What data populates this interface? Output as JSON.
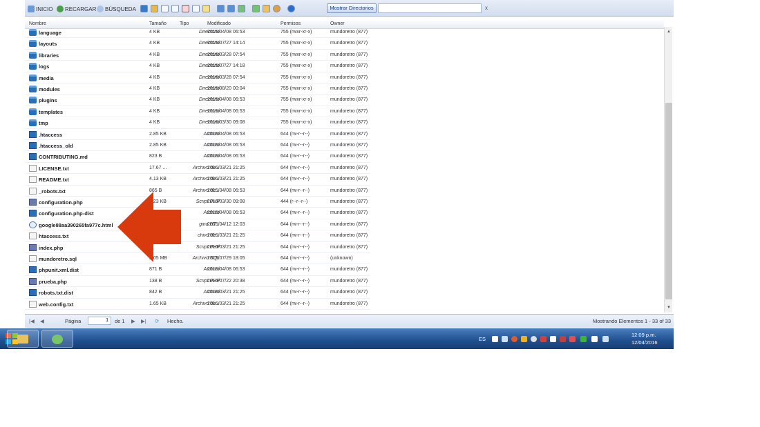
{
  "toolbar": {
    "home": "INICIO",
    "reload": "RECARGAR",
    "search": "BÚSQUEDA",
    "show_dirs": "Mostrar Directorios",
    "search_value": "",
    "clear": "x"
  },
  "columns": {
    "name": "Nombre",
    "size": "Tamaño",
    "type": "Tipo",
    "modified": "Modificado",
    "perms": "Permisos",
    "owner": "Owner"
  },
  "files": [
    {
      "name": "language",
      "icon": "folder-icon",
      "size": "4 KB",
      "type": "Directorio",
      "modified": "2015/04/08 06:53",
      "perms": "755 (rwxr-xr-x)",
      "owner": "mundoretro (877)"
    },
    {
      "name": "layouts",
      "icon": "folder-icon",
      "size": "4 KB",
      "type": "Directorio",
      "modified": "2015/07/27 14:14",
      "perms": "755 (rwxr-xr-x)",
      "owner": "mundoretro (877)"
    },
    {
      "name": "libraries",
      "icon": "folder-icon",
      "size": "4 KB",
      "type": "Directorio",
      "modified": "2016/03/28 07:54",
      "perms": "755 (rwxr-xr-x)",
      "owner": "mundoretro (877)"
    },
    {
      "name": "logs",
      "icon": "folder-icon",
      "size": "4 KB",
      "type": "Directorio",
      "modified": "2015/07/27 14:18",
      "perms": "755 (rwxr-xr-x)",
      "owner": "mundoretro (877)"
    },
    {
      "name": "media",
      "icon": "folder-icon",
      "size": "4 KB",
      "type": "Directorio",
      "modified": "2016/03/28 07:54",
      "perms": "755 (rwxr-xr-x)",
      "owner": "mundoretro (877)"
    },
    {
      "name": "modules",
      "icon": "folder-icon",
      "size": "4 KB",
      "type": "Directorio",
      "modified": "2015/08/20 00:04",
      "perms": "755 (rwxr-xr-x)",
      "owner": "mundoretro (877)"
    },
    {
      "name": "plugins",
      "icon": "folder-icon",
      "size": "4 KB",
      "type": "Directorio",
      "modified": "2015/04/08 06:53",
      "perms": "755 (rwxr-xr-x)",
      "owner": "mundoretro (877)"
    },
    {
      "name": "templates",
      "icon": "folder-icon",
      "size": "4 KB",
      "type": "Directorio",
      "modified": "2015/04/08 06:53",
      "perms": "755 (rwxr-xr-x)",
      "owner": "mundoretro (877)"
    },
    {
      "name": "tmp",
      "icon": "folder-icon",
      "size": "4 KB",
      "type": "Directorio",
      "modified": "2016/03/30 09:08",
      "perms": "755 (rwxr-xr-x)",
      "owner": "mundoretro (877)"
    },
    {
      "name": ".htaccess",
      "icon": "doc-icon",
      "size": "2.85 KB",
      "type": "Archivo",
      "modified": "2015/04/08 06:53",
      "perms": "644 (rw-r--r--)",
      "owner": "mundoretro (877)"
    },
    {
      "name": ".htaccess_old",
      "icon": "doc-icon",
      "size": "2.85 KB",
      "type": "Archivo",
      "modified": "2015/04/08 06:53",
      "perms": "644 (rw-r--r--)",
      "owner": "mundoretro (877)"
    },
    {
      "name": "CONTRIBUTING.md",
      "icon": "doc-icon",
      "size": "823 B",
      "type": "Archivo",
      "modified": "2015/04/08 06:53",
      "perms": "644 (rw-r--r--)",
      "owner": "mundoretro (877)"
    },
    {
      "name": "LICENSE.txt",
      "icon": "text-file-icon",
      "size": "17.67 ...",
      "type": "Archivo de...",
      "modified": "2016/03/21 21:25",
      "perms": "644 (rw-r--r--)",
      "owner": "mundoretro (877)"
    },
    {
      "name": "README.txt",
      "icon": "text-file-icon",
      "size": "4.13 KB",
      "type": "Archivo de...",
      "modified": "2016/03/21 21:25",
      "perms": "644 (rw-r--r--)",
      "owner": "mundoretro (877)"
    },
    {
      "name": "_robots.txt",
      "icon": "text-file-icon",
      "size": "865 B",
      "type": "Archivo de...",
      "modified": "2015/04/08 06:53",
      "perms": "644 (rw-r--r--)",
      "owner": "mundoretro (877)"
    },
    {
      "name": "configuration.php",
      "icon": "php-icon",
      "size": "3.23 KB",
      "type": "Script PHP",
      "modified": "2016/03/30 09:08",
      "perms": "444 (r--r--r--)",
      "owner": "mundoretro (877)"
    },
    {
      "name": "configuration.php-dist",
      "icon": "doc-icon",
      "size": "",
      "type": "Archivo",
      "modified": "2015/04/08 06:53",
      "perms": "644 (rw-r--r--)",
      "owner": "mundoretro (877)"
    },
    {
      "name": "google88aa390265fa977c.html",
      "icon": "html-icon",
      "size": "",
      "type": "gina HT...",
      "modified": "2016/04/12 12:03",
      "perms": "644 (rw-r--r--)",
      "owner": "mundoretro (877)"
    },
    {
      "name": "htaccess.txt",
      "icon": "text-file-icon",
      "size": "",
      "type": "chivo de...",
      "modified": "2016/03/21 21:25",
      "perms": "644 (rw-r--r--)",
      "owner": "mundoretro (877)"
    },
    {
      "name": "index.php",
      "icon": "php-icon",
      "size": "",
      "type": "Script PHP",
      "modified": "2016/03/21 21:25",
      "perms": "644 (rw-r--r--)",
      "owner": "mundoretro (877)"
    },
    {
      "name": "mundoretro.sql",
      "icon": "text-file-icon",
      "size": "2.05 MB",
      "type": "Archivo SQL",
      "modified": "2015/07/29 18:05",
      "perms": "644 (rw-r--r--)",
      "owner": "(unknown)"
    },
    {
      "name": "phpunit.xml.dist",
      "icon": "doc-icon",
      "size": "871 B",
      "type": "Archivo",
      "modified": "2015/04/08 06:53",
      "perms": "644 (rw-r--r--)",
      "owner": "mundoretro (877)"
    },
    {
      "name": "prueba.php",
      "icon": "php-icon",
      "size": "138 B",
      "type": "Script PHP",
      "modified": "2015/07/22 20:38",
      "perms": "644 (rw-r--r--)",
      "owner": "mundoretro (877)"
    },
    {
      "name": "robots.txt.dist",
      "icon": "doc-icon",
      "size": "842 B",
      "type": "Archivo",
      "modified": "2016/03/21 21:25",
      "perms": "644 (rw-r--r--)",
      "owner": "mundoretro (877)"
    },
    {
      "name": "web.config.txt",
      "icon": "text-file-icon",
      "size": "1.65 KB",
      "type": "Archivo de...",
      "modified": "2016/03/21 21:25",
      "perms": "644 (rw-r--r--)",
      "owner": "mundoretro (877)"
    }
  ],
  "paging": {
    "page_label": "Página",
    "page_value": "1",
    "of_label": "de 1",
    "status": "Hecho.",
    "summary": "Mostrando Elementos 1 - 33 of 33"
  },
  "taskbar": {
    "lang": "ES",
    "time": "12:09 p.m.",
    "date": "12/04/2016"
  },
  "colors": {
    "arrow": "#d83a0e",
    "taskbar": "#1f4f8e",
    "toolbar": "#d2ddef"
  }
}
